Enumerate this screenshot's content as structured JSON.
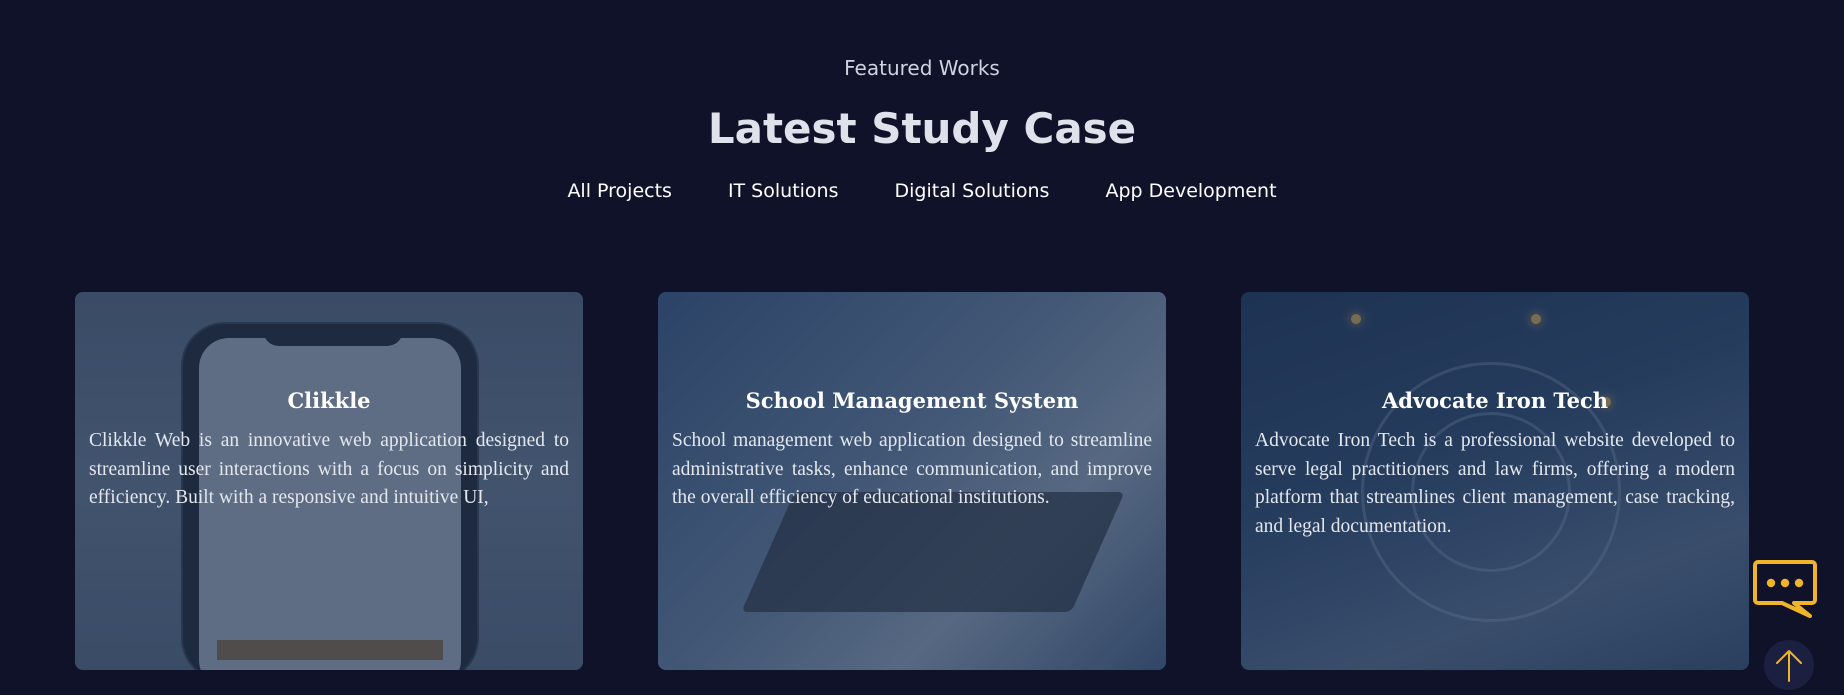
{
  "section": {
    "eyebrow": "Featured Works",
    "title": "Latest Study Case"
  },
  "filters": [
    {
      "label": "All Projects"
    },
    {
      "label": "IT Solutions"
    },
    {
      "label": "Digital Solutions"
    },
    {
      "label": "App Development"
    }
  ],
  "cards": [
    {
      "title": "Clikkle",
      "description": "Clikkle Web is an innovative web application designed to streamline user interactions with a focus on simplicity and efficiency. Built with a responsive and intuitive UI,"
    },
    {
      "title": "School Management System",
      "description": "School management web application designed to streamline administrative tasks, enhance communication, and improve the overall efficiency of educational institutions."
    },
    {
      "title": "Advocate Iron Tech",
      "description": "Advocate Iron Tech is a professional website developed to serve legal practitioners and law firms, offering a modern platform that streamlines client management, case tracking, and legal documentation."
    }
  ],
  "colors": {
    "background": "#10122a",
    "accent": "#f0b429"
  },
  "icons": {
    "chat": "chat-bubble-icon",
    "scroll_top": "arrow-up-icon"
  }
}
